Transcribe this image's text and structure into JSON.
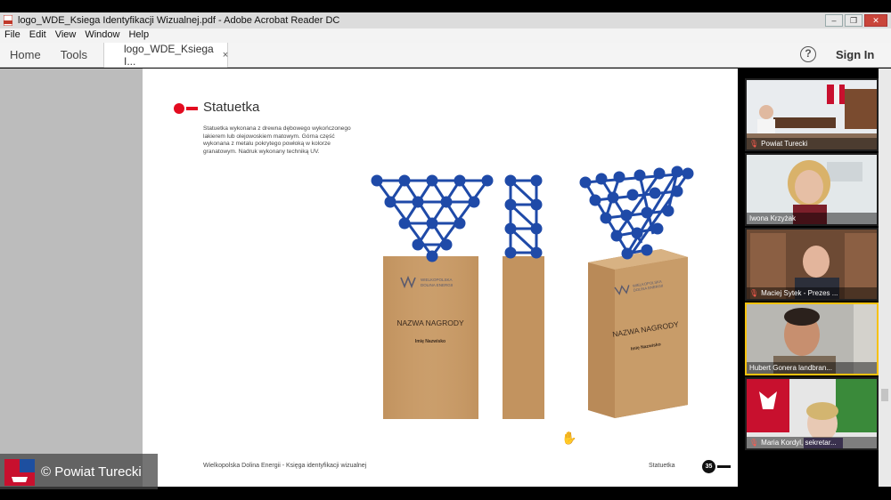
{
  "window": {
    "title": "logo_WDE_Ksiega Identyfikacji Wizualnej.pdf - Adobe Acrobat Reader DC",
    "buttons": [
      "‒",
      "❐",
      "✕"
    ]
  },
  "menu": [
    "File",
    "Edit",
    "Window",
    "Help"
  ],
  "toolbar": {
    "home": "Home",
    "tools": "Tools",
    "doc_tab": "logo_WDE_Ksiega I...",
    "close_tab": "×",
    "help": "?",
    "sign_in": "Sign In"
  },
  "page": {
    "section_title": "Statuetka",
    "description": "Statuetka wykonana z drewna dębowego wykończonego lakierem lub olejowoskiem matowym. Górna część wykonana z metalu pokrytego powłoką w kolorze granatowym. Nadruk wykonany techniką UV.",
    "award_name": "NAZWA NAGRODY",
    "recipient": "Imię Nazwisko",
    "logo_line1": "WIELKOPOLSKA",
    "logo_line2": "DOLINA ENERGII",
    "footer_left": "Wielkopolska Dolina Energii - Księga identyfikacji wizualnej",
    "footer_right": "Statuetka",
    "page_number": "35",
    "accent_color": "#e30b20",
    "metal_color": "#1f4aa8"
  },
  "participants": [
    {
      "name": "Powiat Turecki",
      "muted": true
    },
    {
      "name": "Iwona Krzyżak",
      "muted": false
    },
    {
      "name": "Maciej Sytek - Prezes ...",
      "muted": true
    },
    {
      "name": "Hubert Gonera landbran...",
      "muted": false
    },
    {
      "name": "Maria Kordyl, sekretar...",
      "muted": true
    }
  ],
  "watermark": "© Powiat Turecki"
}
